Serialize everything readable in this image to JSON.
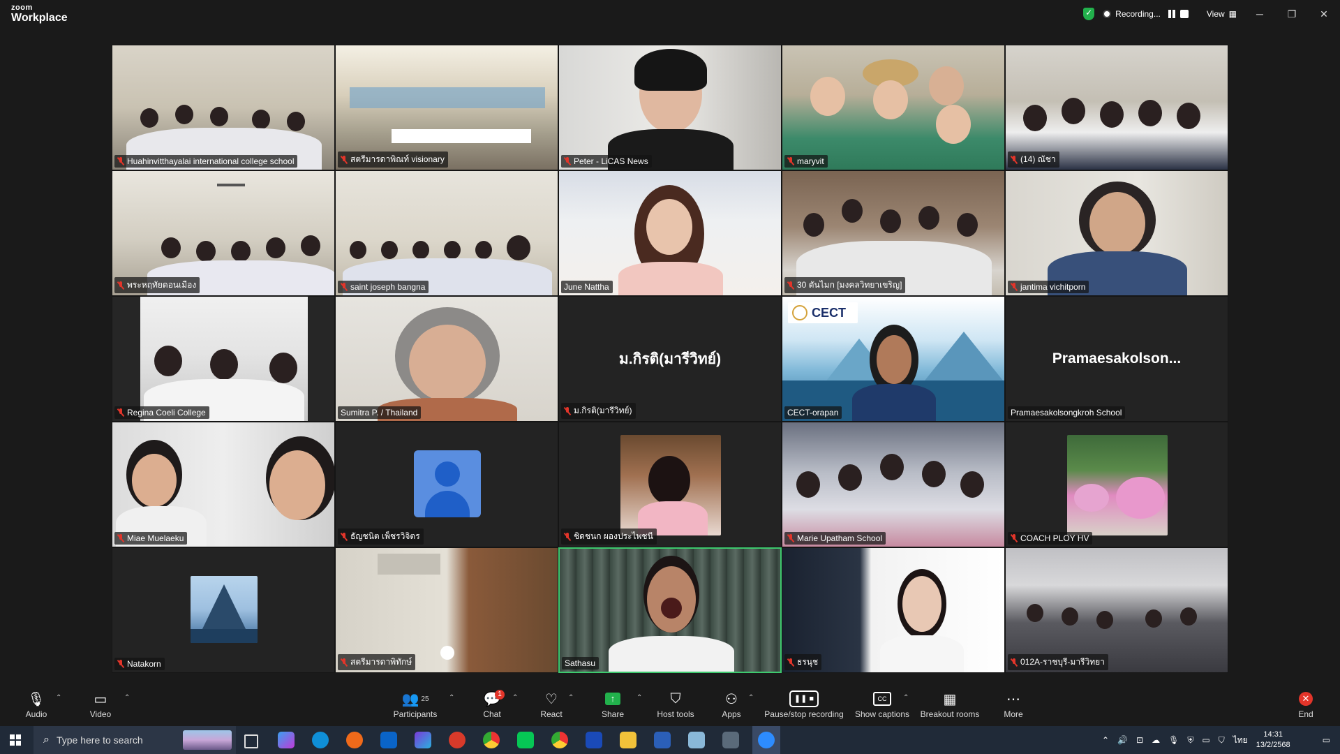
{
  "app": {
    "logo_top": "zoom",
    "logo_bottom": "Workplace"
  },
  "titlebar": {
    "recording_label": "Recording...",
    "view_label": "View",
    "window_controls": [
      "minimize-icon",
      "restore-icon",
      "close-icon"
    ]
  },
  "participants_grid": [
    {
      "name": "Huahinvitthayalai international college school",
      "muted": true
    },
    {
      "name": "สตรีมารดาพิณท์ visionary",
      "muted": true
    },
    {
      "name": "Peter - LiCAS News",
      "muted": true
    },
    {
      "name": "maryvit",
      "muted": true
    },
    {
      "name": "(14) ณัชา",
      "muted": true
    },
    {
      "name": "พระหฤทัยดอนเมือง",
      "muted": true
    },
    {
      "name": "saint joseph bangna",
      "muted": true
    },
    {
      "name": "June Nattha",
      "muted": false
    },
    {
      "name": "30 ตันไมก [มงคลวิทยาเขริญ]",
      "muted": true
    },
    {
      "name": "jantima vichitporn",
      "muted": true
    },
    {
      "name": "Regina Coeli College",
      "muted": true
    },
    {
      "name": "Sumitra P. / Thailand",
      "muted": false
    },
    {
      "name": "ม.กิรติ(มารีวิทย์)",
      "muted": true,
      "center_text": "ม.กิรติ(มารีวิทย์)"
    },
    {
      "name": "CECT-orapan",
      "muted": false,
      "logo_text": "CECT"
    },
    {
      "name": "Pramaesakolsongkroh School",
      "muted": false,
      "center_text": "Pramaesakolson..."
    },
    {
      "name": "Miae Muelaeku",
      "muted": true
    },
    {
      "name": "ธัญชนิต เพ็ชรวิจิตร",
      "muted": true
    },
    {
      "name": "ชิดชนก ผองประไพชนี",
      "muted": true
    },
    {
      "name": "Marie Upatham School",
      "muted": true
    },
    {
      "name": "COACH PLOY HV",
      "muted": true
    },
    {
      "name": "Natakorn",
      "muted": true
    },
    {
      "name": "สตรีมารดาพิทักษ์",
      "muted": true
    },
    {
      "name": "Sathasu",
      "muted": false,
      "active_speaker": true
    },
    {
      "name": "ธรนุช",
      "muted": true
    },
    {
      "name": "012A-ราชบุรี-มารีวิทยา",
      "muted": true
    }
  ],
  "toolbar": {
    "audio": "Audio",
    "video": "Video",
    "participants": "Participants",
    "participants_count": "25",
    "chat": "Chat",
    "chat_badge": "1",
    "react": "React",
    "share": "Share",
    "host_tools": "Host tools",
    "apps": "Apps",
    "pause_stop_recording": "Pause/stop recording",
    "show_captions": "Show captions",
    "breakout_rooms": "Breakout rooms",
    "more": "More",
    "end": "End"
  },
  "taskbar": {
    "search_placeholder": "Type here to search",
    "language": "ไทย",
    "time": "14:31",
    "date": "13/2/2568"
  },
  "colors": {
    "accent_green": "#3ec96e",
    "mute_red": "#e3352a",
    "share_green": "#22b14c",
    "background": "#1a1a1a",
    "taskbar": "#202a38"
  }
}
